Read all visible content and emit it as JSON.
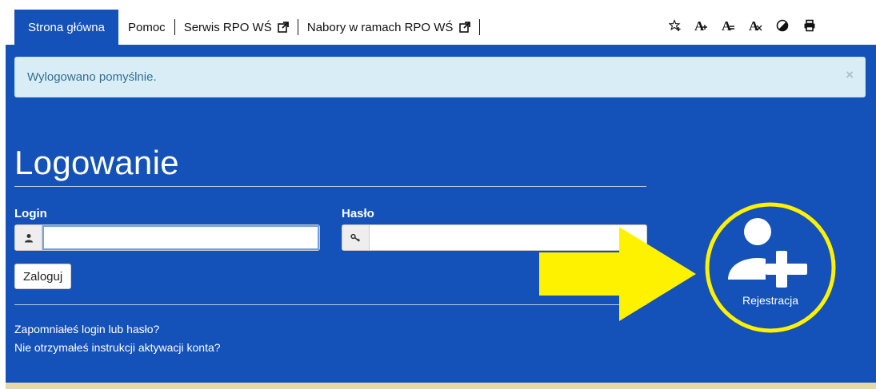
{
  "nav": {
    "active_tab": "Strona główna",
    "links": [
      "Pomoc",
      "Serwis RPO WŚ",
      "Nabory w ramach RPO WŚ"
    ]
  },
  "tools": [
    "favorite-star-icon",
    "font-normal-icon",
    "font-larger-icon",
    "font-largest-icon",
    "contrast-icon",
    "print-icon"
  ],
  "alert": {
    "text": "Wylogowano pomyślnie.",
    "close": "×"
  },
  "login": {
    "title": "Logowanie",
    "login_label": "Login",
    "login_value": "",
    "password_label": "Hasło",
    "password_value": "",
    "submit": "Zaloguj"
  },
  "links": {
    "forgot": "Zapomniałeś login lub hasło?",
    "activation": "Nie otrzymałeś instrukcji aktywacji konta?"
  },
  "register": {
    "label": "Rejestracja"
  },
  "colors": {
    "primary": "#1451b8",
    "highlight": "#fff200",
    "alert_bg": "#d9edf7",
    "gold": "#e7d9a4"
  }
}
